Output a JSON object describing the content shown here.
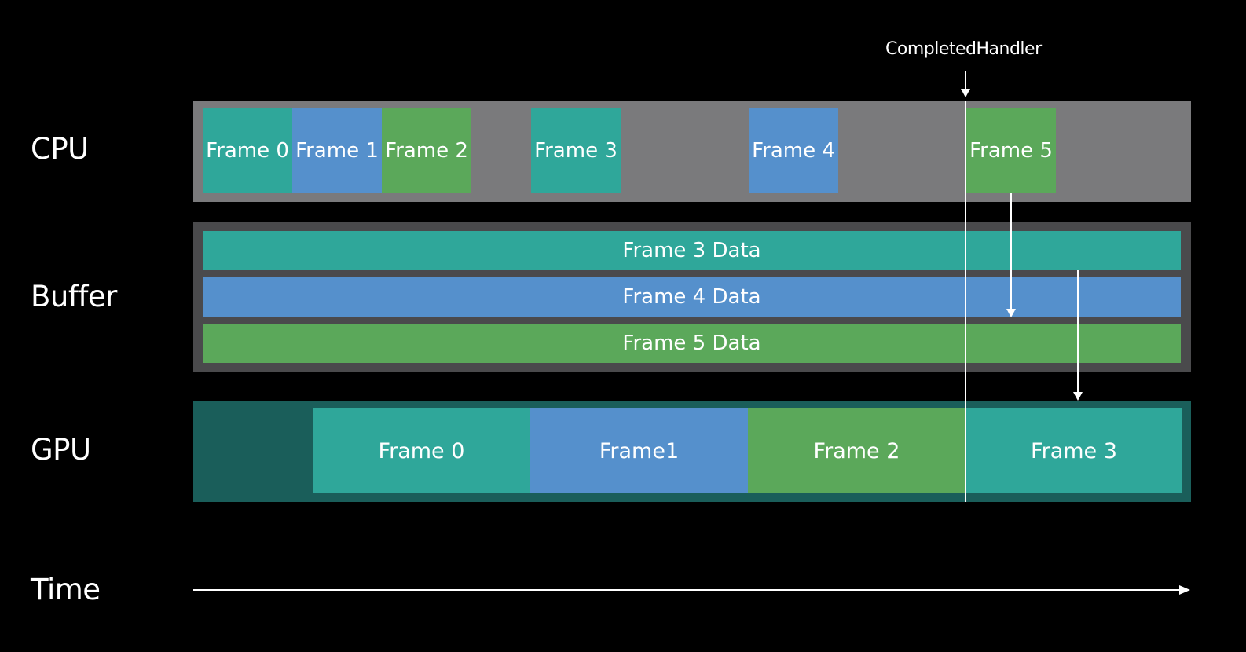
{
  "colors": {
    "teal": "#2fa79a",
    "blue": "#5590cc",
    "green": "#5ba85a",
    "cpu_lane": "#7a7a7c",
    "buffer_lane": "#4a4a4c",
    "gpu_lane": "#1a5e5a"
  },
  "labels": {
    "cpu": "CPU",
    "buffer": "Buffer",
    "gpu": "GPU",
    "time": "Time"
  },
  "annotation": "CompletedHandler",
  "cpu_frames": [
    "Frame 0",
    "Frame 1",
    "Frame 2",
    "Frame 3",
    "Frame 4",
    "Frame 5"
  ],
  "buffer_rows": [
    "Frame 3 Data",
    "Frame 4 Data",
    "Frame 5 Data"
  ],
  "gpu_frames": [
    "Frame 0",
    "Frame1",
    "Frame 2",
    "Frame 3"
  ]
}
